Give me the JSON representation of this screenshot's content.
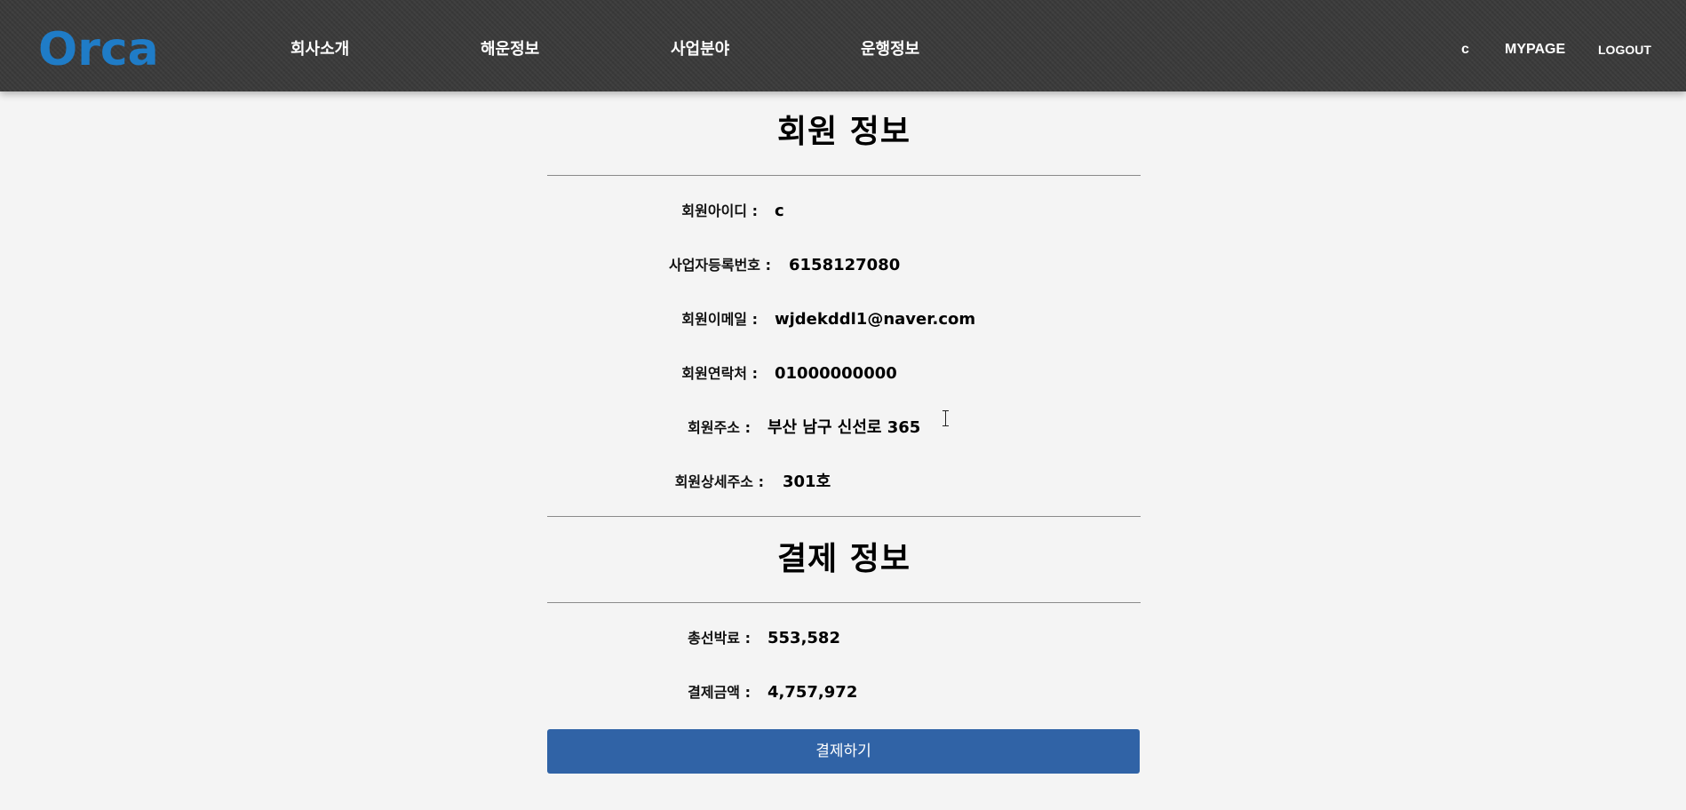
{
  "header": {
    "logo": "Orca",
    "nav": [
      {
        "label": "회사소개"
      },
      {
        "label": "해운정보"
      },
      {
        "label": "사업분야"
      },
      {
        "label": "운행정보"
      }
    ],
    "user_id": "c",
    "mypage_label": "MYPAGE",
    "logout_label": "LOGOUT"
  },
  "member_info": {
    "title": "회원 정보",
    "rows": [
      {
        "label": "회원아이디 :",
        "value": "c"
      },
      {
        "label": "사업자등록번호 :",
        "value": "6158127080"
      },
      {
        "label": "회원이메일 :",
        "value": "wjdekddl1@naver.com"
      },
      {
        "label": "회원연락처 :",
        "value": "01000000000"
      },
      {
        "label": "회원주소 :",
        "value": "부산 남구 신선로 365"
      },
      {
        "label": "회원상세주소 :",
        "value": "301호"
      }
    ]
  },
  "payment_info": {
    "title": "결제 정보",
    "rows": [
      {
        "label": "총선박료 :",
        "value": "553,582"
      },
      {
        "label": "결제금액 :",
        "value": "4,757,972"
      }
    ],
    "button_label": "결제하기"
  },
  "colors": {
    "header_bg": "#3a3a3a",
    "logo": "#1f7cc7",
    "button_bg": "#3063a6",
    "page_bg": "#f4f4f4"
  },
  "icons": {
    "cursor": "text-cursor-icon"
  }
}
